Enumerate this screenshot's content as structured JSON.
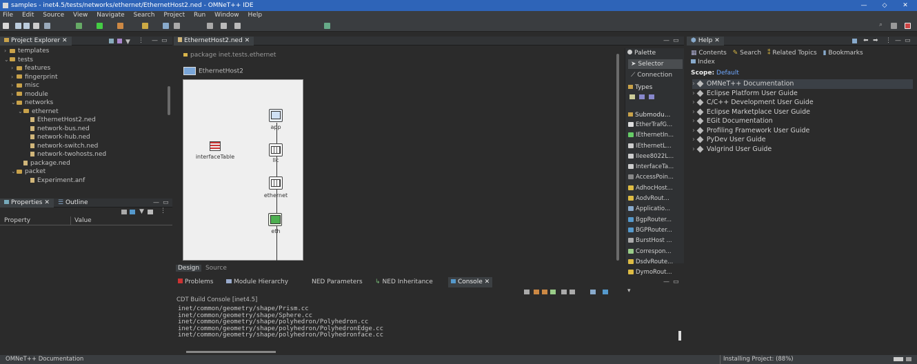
{
  "window": {
    "title": "samples - inet4.5/tests/networks/ethernet/EthernetHost2.ned - OMNeT++ IDE"
  },
  "menu": [
    "File",
    "Edit",
    "Source",
    "View",
    "Navigate",
    "Search",
    "Project",
    "Run",
    "Window",
    "Help"
  ],
  "project_explorer": {
    "tab": "Project Explorer",
    "items": [
      {
        "label": "templates",
        "kind": "folder",
        "indent": 1
      },
      {
        "label": "tests",
        "kind": "folder",
        "indent": 1,
        "open": true
      },
      {
        "label": "features",
        "kind": "folder",
        "indent": 2
      },
      {
        "label": "fingerprint",
        "kind": "folder",
        "indent": 2
      },
      {
        "label": "misc",
        "kind": "folder",
        "indent": 2
      },
      {
        "label": "module",
        "kind": "folder",
        "indent": 2
      },
      {
        "label": "networks",
        "kind": "folder",
        "indent": 2,
        "open": true
      },
      {
        "label": "ethernet",
        "kind": "folder",
        "indent": 3,
        "open": true
      },
      {
        "label": "EthernetHost2.ned",
        "kind": "file",
        "indent": 4
      },
      {
        "label": "network-bus.ned",
        "kind": "file",
        "indent": 4
      },
      {
        "label": "network-hub.ned",
        "kind": "file",
        "indent": 4
      },
      {
        "label": "network-switch.ned",
        "kind": "file",
        "indent": 4
      },
      {
        "label": "network-twohosts.ned",
        "kind": "file",
        "indent": 4
      },
      {
        "label": "package.ned",
        "kind": "file",
        "indent": 3
      },
      {
        "label": "packet",
        "kind": "folder",
        "indent": 2,
        "open": true
      },
      {
        "label": "Experiment.anf",
        "kind": "file",
        "indent": 4
      }
    ]
  },
  "properties": {
    "tab": "Properties",
    "outline_tab": "Outline",
    "col_property": "Property",
    "col_value": "Value"
  },
  "editor": {
    "tab": "EthernetHost2.ned",
    "package": "package inet.tests.ethernet",
    "module": "EthernetHost2",
    "nodes": {
      "table": "interfaceTable",
      "app": "app",
      "llc": "llc",
      "ethernet": "ethernet",
      "eth": "eth"
    },
    "design_tab": "Design",
    "source_tab": "Source"
  },
  "palette": {
    "title": "Palette",
    "selector": "Selector",
    "connection": "Connection",
    "types": "Types",
    "submodules": "Submodu...",
    "items": [
      "EtherTrafG...",
      "IEthernetIn...",
      "IEthernetL...",
      "IIeee8022L...",
      "InterfaceTa...",
      "AccessPoin...",
      "AdhocHost...",
      "AodvRout...",
      "Applicatio...",
      "BgpRouter...",
      "BGPRouter...",
      "BurstHost ...",
      "Correspon...",
      "DsdvRoute...",
      "DymoRout..."
    ]
  },
  "bottom": {
    "tabs": [
      "Problems",
      "Module Hierarchy",
      "NED Parameters",
      "NED Inheritance",
      "Console"
    ],
    "console_title": "CDT Build Console [inet4.5]",
    "lines": [
      "inet/common/geometry/shape/Prism.cc",
      "inet/common/geometry/shape/Sphere.cc",
      "inet/common/geometry/shape/polyhedron/Polyhedron.cc",
      "inet/common/geometry/shape/polyhedron/PolyhedronEdge.cc",
      "inet/common/geometry/shape/polyhedron/Polyhedronface.cc"
    ]
  },
  "help": {
    "tab": "Help",
    "nav": [
      "Contents",
      "Search",
      "Related Topics",
      "Bookmarks"
    ],
    "index": "Index",
    "scope_label": "Scope:",
    "scope_value": "Default",
    "items": [
      "OMNeT++ Documentation",
      "Eclipse Platform User Guide",
      "C/C++ Development User Guide",
      "Eclipse Marketplace User Guide",
      "EGit Documentation",
      "Profiling Framework User Guide",
      "PyDev User Guide",
      "Valgrind User Guide"
    ]
  },
  "status": {
    "left": "OMNeT++ Documentation",
    "right": "Installing Project: (88%)"
  }
}
